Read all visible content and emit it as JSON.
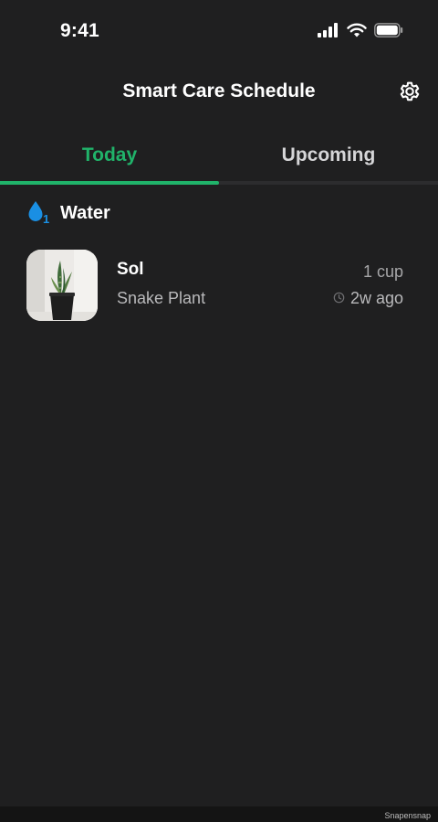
{
  "status_bar": {
    "time": "9:41"
  },
  "header": {
    "title": "Smart Care Schedule",
    "settings_icon": "gear-icon"
  },
  "tabs": [
    {
      "label": "Today",
      "active": true
    },
    {
      "label": "Upcoming",
      "active": false
    }
  ],
  "colors": {
    "background": "#1f1f20",
    "accent": "#20b36a",
    "water": "#1a8fe3",
    "muted_text": "#b9b9bb"
  },
  "section": {
    "title": "Water",
    "icon": "water-drop-icon",
    "badge": "1"
  },
  "plants": [
    {
      "name": "Sol",
      "species": "Snake Plant",
      "amount": "1 cup",
      "last_watered": "2w ago",
      "last_watered_icon": "clock-icon"
    }
  ],
  "watermark": "Snapensnap"
}
